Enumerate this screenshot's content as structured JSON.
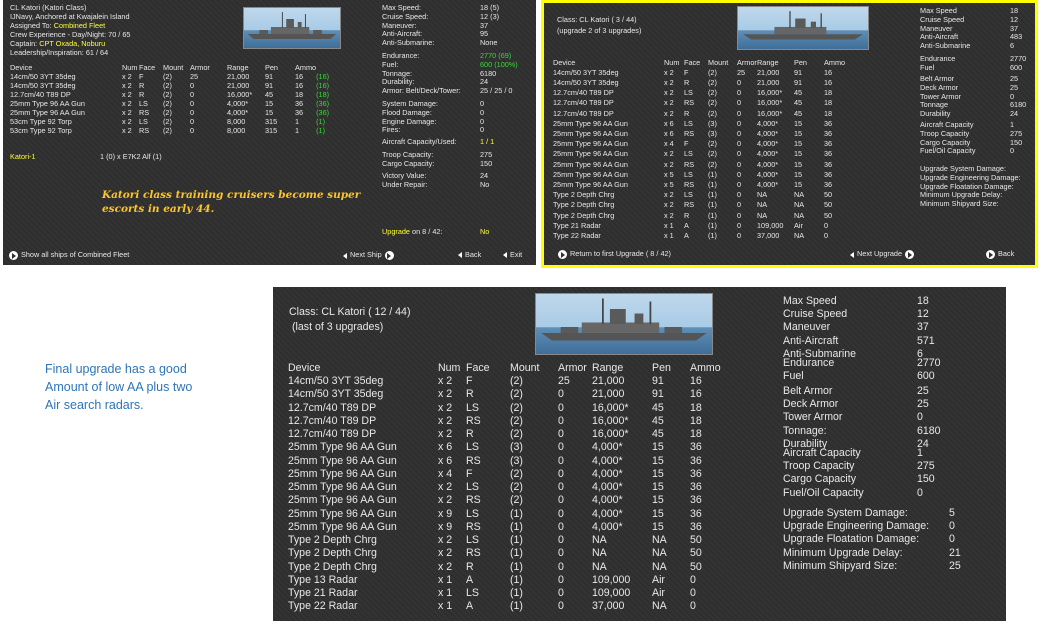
{
  "panel1": {
    "header": {
      "ship_name": "CL Katori (Katori Class)",
      "status": "IJNavy, Anchored at Kwajalein Island",
      "assigned_label": "Assigned To:",
      "assigned_value": "Combined Fleet",
      "crew": "Crew Experience - Day/Night: 70 / 65",
      "captain_label": "Captain:",
      "captain_value": "CPT Oxada, Noburu",
      "leadership": "Leadership/Inspiration: 61 / 64"
    },
    "stats": [
      {
        "k": "Max Speed:",
        "v": "18 (5)"
      },
      {
        "k": "Cruise Speed:",
        "v": "12 (3)"
      },
      {
        "k": "Maneuver:",
        "v": "37"
      },
      {
        "k": "Anti-Aircraft:",
        "v": "95"
      },
      {
        "k": "Anti-Submarine:",
        "v": "None"
      }
    ],
    "stats2": [
      {
        "k": "Endurance:",
        "v": "2770 (69)",
        "c": "green"
      },
      {
        "k": "Fuel:",
        "v": "600 (100%)",
        "c": "green"
      },
      {
        "k": "Tonnage:",
        "v": "6180",
        "c": ""
      },
      {
        "k": "Durability:",
        "v": "24",
        "c": ""
      },
      {
        "k": "Armor: Belt/Deck/Tower:",
        "v": "25 / 25 / 0",
        "c": ""
      }
    ],
    "stats3": [
      {
        "k": "System Damage:",
        "v": "0"
      },
      {
        "k": "Flood Damage:",
        "v": "0"
      },
      {
        "k": "Engine Damage:",
        "v": "0"
      },
      {
        "k": "Fires:",
        "v": "0"
      }
    ],
    "aircraft": {
      "k": "Aircraft Capacity/Used:",
      "v": "1 / 1"
    },
    "stats4": [
      {
        "k": "Troop Capacity:",
        "v": "275"
      },
      {
        "k": "Cargo Capacity:",
        "v": "150"
      }
    ],
    "stats5": [
      {
        "k": "Victory Value:",
        "v": "24"
      },
      {
        "k": "Under Repair:",
        "v": "No"
      }
    ],
    "upgrade": {
      "k": "Upgrade",
      "on": "on 8 / 42:",
      "v": "No"
    },
    "columns": [
      "Device",
      "Num",
      "Face",
      "Mount",
      "Armor",
      "Range",
      "Pen",
      "Ammo"
    ],
    "devices": [
      [
        "14cm/50 3YT 35deg",
        "x 2",
        "F",
        "(2)",
        "25",
        "21,000",
        "91",
        "16",
        "(16)"
      ],
      [
        "14cm/50 3YT 35deg",
        "x 2",
        "R",
        "(2)",
        "0",
        "21,000",
        "91",
        "16",
        "(16)"
      ],
      [
        "12.7cm/40 T89 DP",
        "x 2",
        "R",
        "(2)",
        "0",
        "16,000*",
        "45",
        "18",
        "(18)"
      ],
      [
        "25mm Type 96 AA Gun",
        "x 2",
        "LS",
        "(2)",
        "0",
        "4,000*",
        "15",
        "36",
        "(36)"
      ],
      [
        "25mm Type 96 AA Gun",
        "x 2",
        "RS",
        "(2)",
        "0",
        "4,000*",
        "15",
        "36",
        "(36)"
      ],
      [
        "53cm Type 92 Torp",
        "x 2",
        "LS",
        "(2)",
        "0",
        "8,000",
        "315",
        "1",
        "(1)"
      ],
      [
        "53cm Type 92 Torp",
        "x 2",
        "RS",
        "(2)",
        "0",
        "8,000",
        "315",
        "1",
        "(1)"
      ]
    ],
    "air_group": "Katori-1",
    "air_detail": "1 (0) x E7K2 Alf (1)",
    "caption": "Katori class training cruisers become super escorts in early 44.",
    "nav": {
      "show_all": "Show all ships of Combined Fleet",
      "next": "Next Ship",
      "back": "Back",
      "exit": "Exit"
    }
  },
  "panel2": {
    "class_line": "Class: CL Katori  ( 3 / 44)",
    "upgrade_line": "(upgrade 2 of 3 upgrades)",
    "stats": [
      {
        "k": "Max Speed",
        "v": "18"
      },
      {
        "k": "Cruise Speed",
        "v": "12"
      },
      {
        "k": "Maneuver",
        "v": "37"
      },
      {
        "k": "Anti-Aircraft",
        "v": "483"
      },
      {
        "k": "Anti-Submarine",
        "v": "6"
      }
    ],
    "stats2": [
      {
        "k": "Endurance",
        "v": "2770"
      },
      {
        "k": "Fuel",
        "v": "600"
      }
    ],
    "stats3": [
      {
        "k": "Belt Armor",
        "v": "25"
      },
      {
        "k": "Deck Armor",
        "v": "25"
      },
      {
        "k": "Tower Armor",
        "v": "0"
      },
      {
        "k": "Tonnage",
        "v": "6180"
      },
      {
        "k": "Durability",
        "v": "24"
      }
    ],
    "stats4": [
      {
        "k": "Aircraft Capacity",
        "v": "1"
      },
      {
        "k": "Troop Capacity",
        "v": "275"
      },
      {
        "k": "Cargo Capacity",
        "v": "150"
      },
      {
        "k": "Fuel/Oil Capacity",
        "v": "0"
      }
    ],
    "stats5": [
      {
        "k": "Upgrade System Damage:",
        "v": ""
      },
      {
        "k": "Upgrade Engineering Damage:",
        "v": ""
      },
      {
        "k": "Upgrade Floatation Damage:",
        "v": ""
      },
      {
        "k": "Minimum Upgrade Delay:",
        "v": ""
      },
      {
        "k": "Minimum Shipyard Size:",
        "v": ""
      }
    ],
    "columns": [
      "Device",
      "Num",
      "Face",
      "Mount",
      "Armor",
      "Range",
      "Pen",
      "Ammo"
    ],
    "devices": [
      [
        "14cm/50 3YT 35deg",
        "x 2",
        "F",
        "(2)",
        "25",
        "21,000",
        "91",
        "16"
      ],
      [
        "14cm/50 3YT 35deg",
        "x 2",
        "R",
        "(2)",
        "0",
        "21,000",
        "91",
        "16"
      ],
      [
        "12.7cm/40 T89 DP",
        "x 2",
        "LS",
        "(2)",
        "0",
        "16,000*",
        "45",
        "18"
      ],
      [
        "12.7cm/40 T89 DP",
        "x 2",
        "RS",
        "(2)",
        "0",
        "16,000*",
        "45",
        "18"
      ],
      [
        "12.7cm/40 T89 DP",
        "x 2",
        "R",
        "(2)",
        "0",
        "16,000*",
        "45",
        "18"
      ],
      [
        "25mm Type 96 AA Gun",
        "x 6",
        "LS",
        "(3)",
        "0",
        "4,000*",
        "15",
        "36"
      ],
      [
        "25mm Type 96 AA Gun",
        "x 6",
        "RS",
        "(3)",
        "0",
        "4,000*",
        "15",
        "36"
      ],
      [
        "25mm Type 96 AA Gun",
        "x 4",
        "F",
        "(2)",
        "0",
        "4,000*",
        "15",
        "36"
      ],
      [
        "25mm Type 96 AA Gun",
        "x 2",
        "LS",
        "(2)",
        "0",
        "4,000*",
        "15",
        "36"
      ],
      [
        "25mm Type 96 AA Gun",
        "x 2",
        "RS",
        "(2)",
        "0",
        "4,000*",
        "15",
        "36"
      ],
      [
        "25mm Type 96 AA Gun",
        "x 5",
        "LS",
        "(1)",
        "0",
        "4,000*",
        "15",
        "36"
      ],
      [
        "25mm Type 96 AA Gun",
        "x 5",
        "RS",
        "(1)",
        "0",
        "4,000*",
        "15",
        "36"
      ],
      [
        "Type 2 Depth Chrg",
        "x 2",
        "LS",
        "(1)",
        "0",
        "NA",
        "NA",
        "50"
      ],
      [
        "Type 2 Depth Chrg",
        "x 2",
        "RS",
        "(1)",
        "0",
        "NA",
        "NA",
        "50"
      ],
      [
        "Type 2 Depth Chrg",
        "x 2",
        "R",
        "(1)",
        "0",
        "NA",
        "NA",
        "50"
      ],
      [
        "Type 21 Radar",
        "x 1",
        "A",
        "(1)",
        "0",
        "109,000",
        "Air",
        "0"
      ],
      [
        "Type 22 Radar",
        "x 1",
        "A",
        "(1)",
        "0",
        "37,000",
        "NA",
        "0"
      ]
    ],
    "nav": {
      "return": "Return to first Upgrade ( 8 / 42)",
      "next": "Next Upgrade",
      "back": "Back"
    }
  },
  "panel3": {
    "class_line": "Class: CL Katori  ( 12 / 44)",
    "upgrade_line": "(last of 3 upgrades)",
    "stats": [
      {
        "k": "Max Speed",
        "v": "18"
      },
      {
        "k": "Cruise Speed",
        "v": "12"
      },
      {
        "k": "Maneuver",
        "v": "37"
      },
      {
        "k": "Anti-Aircraft",
        "v": "571"
      },
      {
        "k": "Anti-Submarine",
        "v": "6"
      }
    ],
    "stats2": [
      {
        "k": "Endurance",
        "v": "2770"
      },
      {
        "k": "Fuel",
        "v": "600"
      }
    ],
    "stats3": [
      {
        "k": "Belt Armor",
        "v": "25"
      },
      {
        "k": "Deck Armor",
        "v": "25"
      },
      {
        "k": "Tower Armor",
        "v": "0"
      },
      {
        "k": "Tonnage:",
        "v": "6180"
      },
      {
        "k": "Durability",
        "v": "24"
      }
    ],
    "stats4": [
      {
        "k": "Aircraft Capacity",
        "v": "1"
      },
      {
        "k": "Troop Capacity",
        "v": "275"
      },
      {
        "k": "Cargo Capacity",
        "v": "150"
      },
      {
        "k": "Fuel/Oil Capacity",
        "v": "0"
      }
    ],
    "stats5": [
      {
        "k": "Upgrade System Damage:",
        "v": "5"
      },
      {
        "k": "Upgrade Engineering Damage:",
        "v": "0"
      },
      {
        "k": "Upgrade Floatation Damage:",
        "v": "0"
      },
      {
        "k": "Minimum Upgrade Delay:",
        "v": "21"
      },
      {
        "k": "Minimum Shipyard Size:",
        "v": "25"
      }
    ],
    "columns": [
      "Device",
      "Num",
      "Face",
      "Mount",
      "Armor",
      "Range",
      "Pen",
      "Ammo"
    ],
    "devices": [
      [
        "14cm/50 3YT 35deg",
        "x 2",
        "F",
        "(2)",
        "25",
        "21,000",
        "91",
        "16"
      ],
      [
        "14cm/50 3YT 35deg",
        "x 2",
        "R",
        "(2)",
        "0",
        "21,000",
        "91",
        "16"
      ],
      [
        "12.7cm/40 T89 DP",
        "x 2",
        "LS",
        "(2)",
        "0",
        "16,000*",
        "45",
        "18"
      ],
      [
        "12.7cm/40 T89 DP",
        "x 2",
        "RS",
        "(2)",
        "0",
        "16,000*",
        "45",
        "18"
      ],
      [
        "12.7cm/40 T89 DP",
        "x 2",
        "R",
        "(2)",
        "0",
        "16,000*",
        "45",
        "18"
      ],
      [
        "25mm Type 96 AA Gun",
        "x 6",
        "LS",
        "(3)",
        "0",
        "4,000*",
        "15",
        "36"
      ],
      [
        "25mm Type 96 AA Gun",
        "x 6",
        "RS",
        "(3)",
        "0",
        "4,000*",
        "15",
        "36"
      ],
      [
        "25mm Type 96 AA Gun",
        "x 4",
        "F",
        "(2)",
        "0",
        "4,000*",
        "15",
        "36"
      ],
      [
        "25mm Type 96 AA Gun",
        "x 2",
        "LS",
        "(2)",
        "0",
        "4,000*",
        "15",
        "36"
      ],
      [
        "25mm Type 96 AA Gun",
        "x 2",
        "RS",
        "(2)",
        "0",
        "4,000*",
        "15",
        "36"
      ],
      [
        "25mm Type 96 AA Gun",
        "x 9",
        "LS",
        "(1)",
        "0",
        "4,000*",
        "15",
        "36"
      ],
      [
        "25mm Type 96 AA Gun",
        "x 9",
        "RS",
        "(1)",
        "0",
        "4,000*",
        "15",
        "36"
      ],
      [
        "Type 2 Depth Chrg",
        "x 2",
        "LS",
        "(1)",
        "0",
        "NA",
        "NA",
        "50"
      ],
      [
        "Type 2 Depth Chrg",
        "x 2",
        "RS",
        "(1)",
        "0",
        "NA",
        "NA",
        "50"
      ],
      [
        "Type 2 Depth Chrg",
        "x 2",
        "R",
        "(1)",
        "0",
        "NA",
        "NA",
        "50"
      ],
      [
        "Type 13 Radar",
        "x 1",
        "A",
        "(1)",
        "0",
        "109,000",
        "Air",
        "0"
      ],
      [
        "Type 21 Radar",
        "x 1",
        "LS",
        "(1)",
        "0",
        "109,000",
        "Air",
        "0"
      ],
      [
        "Type 22 Radar",
        "x 1",
        "A",
        "(1)",
        "0",
        "37,000",
        "NA",
        "0"
      ]
    ]
  },
  "note": {
    "line1": "Final upgrade has a good",
    "line2": "Amount of low AA plus two",
    "line3": "Air search radars."
  },
  "colors": {
    "highlight_border": "#ffff00",
    "accent_yellow": "#ffff33",
    "accent_green": "#33dd33",
    "caption_orange": "#ffc428",
    "note_blue": "#2e75b6"
  }
}
